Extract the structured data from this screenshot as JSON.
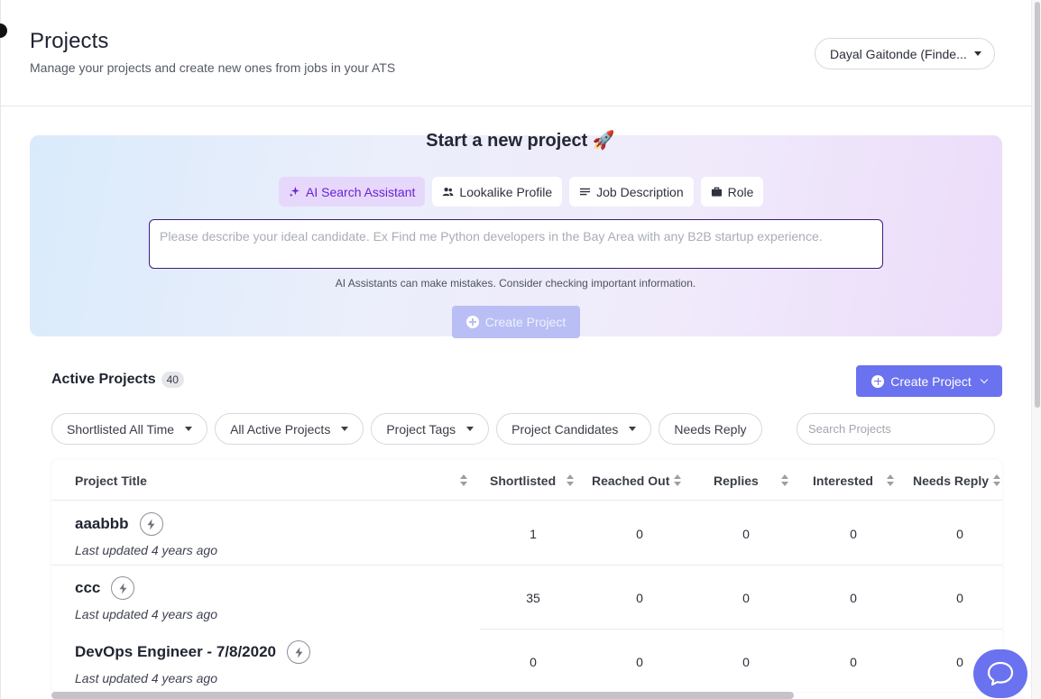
{
  "header": {
    "title": "Projects",
    "subtitle": "Manage your projects and create new ones from jobs in your ATS",
    "account": "Dayal Gaitonde (Finde..."
  },
  "new_project": {
    "title": "Start a new project 🚀",
    "tabs": [
      {
        "label": "AI Search Assistant",
        "icon": "sparkle-icon",
        "active": true
      },
      {
        "label": "Lookalike Profile",
        "icon": "people-icon",
        "active": false
      },
      {
        "label": "Job Description",
        "icon": "lines-icon",
        "active": false
      },
      {
        "label": "Role",
        "icon": "briefcase-icon",
        "active": false
      }
    ],
    "prompt_placeholder": "Please describe your ideal candidate. Ex Find me Python developers in the Bay Area with any B2B startup experience.",
    "disclaimer": "AI Assistants can make mistakes. Consider checking important information.",
    "create_label": "Create Project"
  },
  "active": {
    "title": "Active Projects",
    "count": "40",
    "create_label": "Create Project",
    "filters": [
      {
        "label": "Shortlisted All Time",
        "dropdown": true
      },
      {
        "label": "All Active Projects",
        "dropdown": true
      },
      {
        "label": "Project Tags",
        "dropdown": true
      },
      {
        "label": "Project Candidates",
        "dropdown": true
      },
      {
        "label": "Needs Reply",
        "dropdown": false
      }
    ],
    "search_placeholder": "Search Projects"
  },
  "table": {
    "columns": [
      "Project Title",
      "Shortlisted",
      "Reached Out",
      "Replies",
      "Interested",
      "Needs Reply"
    ],
    "rows": [
      {
        "title": "aaabbb",
        "updated": "Last updated 4 years ago",
        "values": [
          "1",
          "0",
          "0",
          "0",
          "0"
        ]
      },
      {
        "title": "ccc",
        "updated": "Last updated 4 years ago",
        "values": [
          "35",
          "0",
          "0",
          "0",
          "0"
        ]
      },
      {
        "title": "DevOps Engineer - 7/8/2020",
        "updated": "Last updated 4 years ago",
        "values": [
          "0",
          "0",
          "0",
          "0",
          "0"
        ]
      }
    ]
  },
  "colors": {
    "accent": "#6a72ef",
    "active_tab_bg": "#e6d8fb",
    "active_tab_text": "#6a22d8"
  }
}
